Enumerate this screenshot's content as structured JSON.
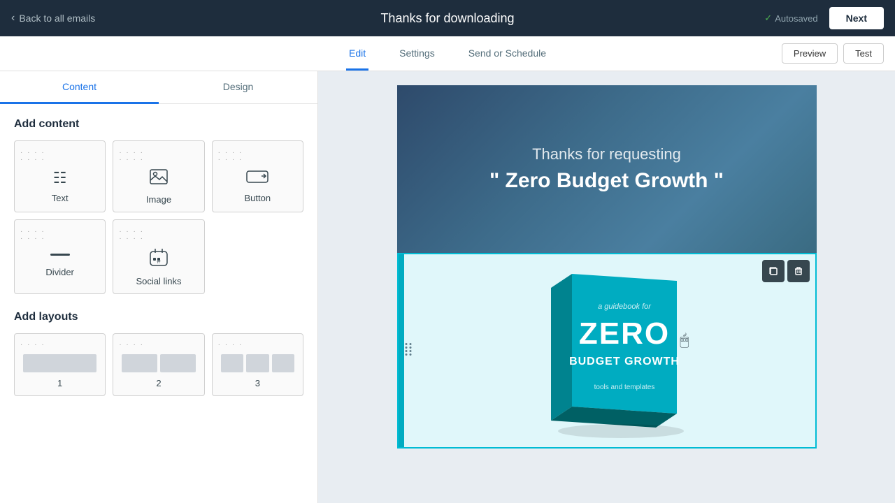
{
  "topNav": {
    "backLabel": "Back to all emails",
    "title": "Thanks for downloading",
    "autosaved": "Autosaved",
    "nextLabel": "Next"
  },
  "tabs": {
    "items": [
      "Edit",
      "Settings",
      "Send or Schedule"
    ],
    "activeIndex": 0,
    "previewLabel": "Preview",
    "testLabel": "Test"
  },
  "leftPanel": {
    "panelTabs": [
      "Content",
      "Design"
    ],
    "activePanelTab": 0,
    "addContentTitle": "Add content",
    "contentItems": [
      {
        "id": "text",
        "label": "Text",
        "icon": "text"
      },
      {
        "id": "image",
        "label": "Image",
        "icon": "image"
      },
      {
        "id": "button",
        "label": "Button",
        "icon": "button"
      },
      {
        "id": "divider",
        "label": "Divider",
        "icon": "divider"
      },
      {
        "id": "social",
        "label": "Social links",
        "icon": "social"
      }
    ],
    "addLayoutsTitle": "Add layouts",
    "layoutItems": [
      {
        "id": "1col",
        "label": "1",
        "cols": 1
      },
      {
        "id": "2col",
        "label": "2",
        "cols": 2
      },
      {
        "id": "3col",
        "label": "3",
        "cols": 3
      }
    ]
  },
  "canvas": {
    "bannerSubtitle": "Thanks for requesting",
    "bannerTitle": "\" Zero Budget Growth \"",
    "bookBlockSelected": true
  },
  "book": {
    "topText": "a guidebook for",
    "titleLine1": "ZERO",
    "titleLine2": "BUDGET GROWTH",
    "bottomText": "tools and templates"
  }
}
